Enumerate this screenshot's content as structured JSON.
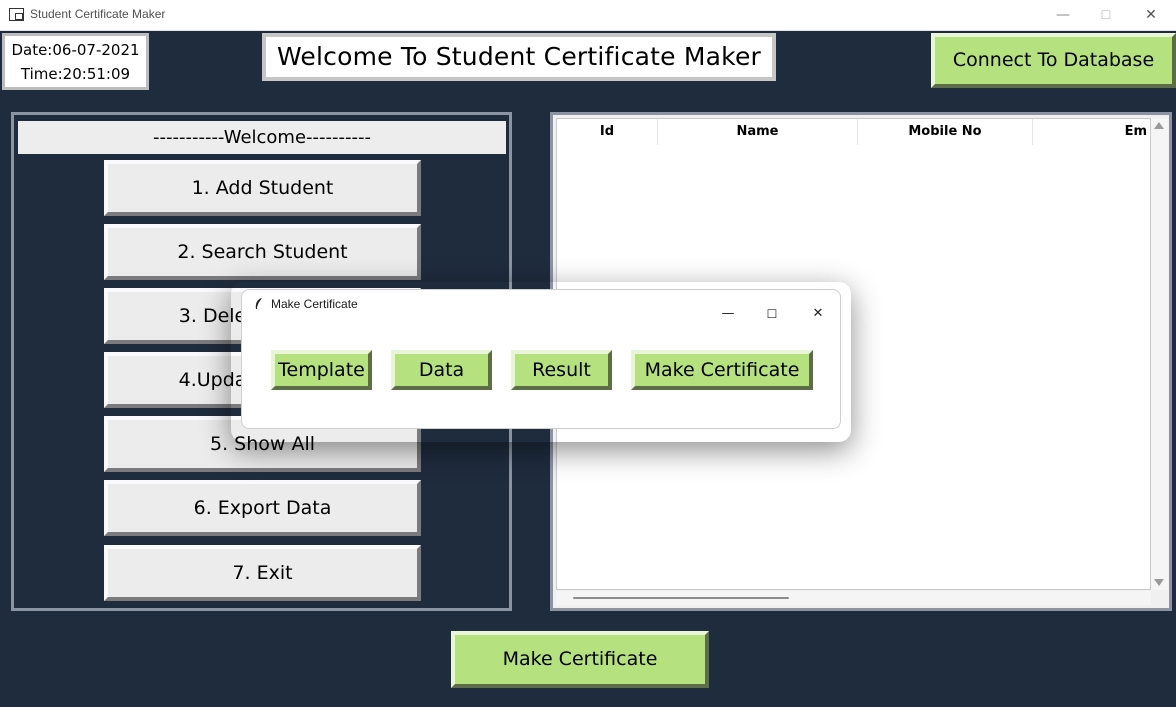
{
  "window": {
    "title": "Student Certificate Maker",
    "controls": {
      "minimize": "—",
      "maximize": "☐",
      "close": "✕"
    }
  },
  "datetime": {
    "date": "Date:06-07-2021",
    "time": "Time:20:51:09"
  },
  "header": {
    "title": "Welcome To Student Certificate Maker",
    "connect_label": "Connect To Database"
  },
  "menu": {
    "welcome": "-----------Welcome----------",
    "items": [
      "1. Add Student",
      "2. Search Student",
      "3. Delete Student",
      "4.Update Student",
      "5. Show All",
      "6. Export Data",
      "7. Exit"
    ]
  },
  "table": {
    "columns": [
      "Id",
      "Name",
      "Mobile No",
      "Em"
    ]
  },
  "footer": {
    "make_certificate_label": "Make Certificate"
  },
  "dialog": {
    "title": "Make Certificate",
    "buttons": [
      "Template",
      "Data",
      "Result",
      "Make Certificate"
    ],
    "controls": {
      "minimize": "—",
      "maximize": "☐",
      "close": "✕"
    }
  },
  "colors": {
    "background": "#1f2c3e",
    "green_button": "#b5e27f",
    "menu_button": "#ececec"
  }
}
